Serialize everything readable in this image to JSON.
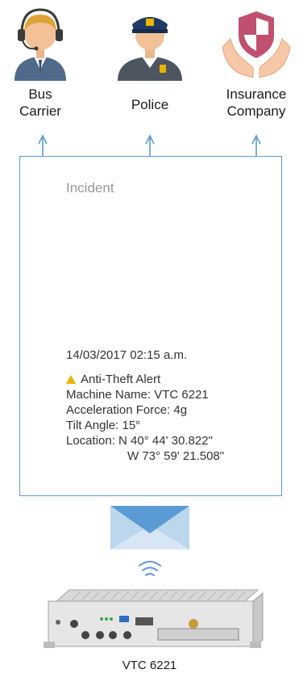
{
  "recipients": {
    "bus_carrier": "Bus\nCarrier",
    "police": "Police",
    "insurance": "Insurance\nCompany"
  },
  "incident": {
    "title": "Incident",
    "timestamp": "14/03/2017  02:15 a.m.",
    "alert": "Anti-Theft Alert",
    "machine_name": "Machine Name: VTC 6221",
    "acceleration": "Acceleration Force: 4g",
    "tilt": "Tilt Angle:  15°",
    "location_line1": "Location: N 40° 44' 30.822\"",
    "location_line2": "W 73° 59' 21.508\""
  },
  "device": {
    "label": "VTC 6221"
  },
  "icons": [
    "headset-agent-icon",
    "police-officer-icon",
    "insurance-shield-icon",
    "satellite-icon",
    "bus-icon",
    "thief-icon",
    "envelope-icon",
    "wifi-icon",
    "device-box-icon",
    "warning-icon"
  ],
  "colors": {
    "line": "#5a9bd5",
    "envelope_top": "#5b9bd5",
    "envelope_body": "#bcd6ee",
    "warning": "#e8b400",
    "shield": "#c0506e"
  }
}
